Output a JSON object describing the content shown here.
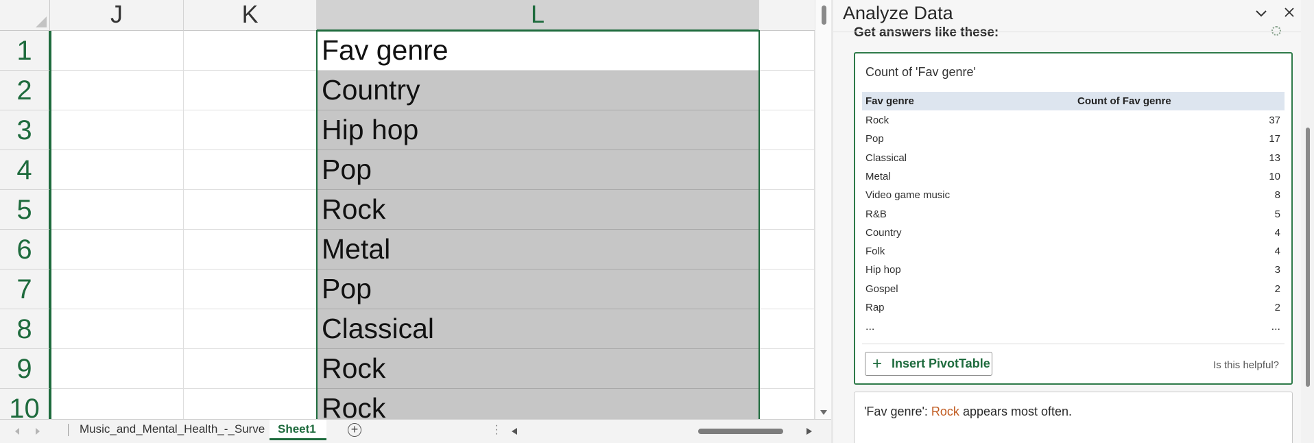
{
  "grid": {
    "columns": [
      "J",
      "K",
      "L"
    ],
    "row_numbers": [
      "1",
      "2",
      "3",
      "4",
      "5",
      "6",
      "7",
      "8",
      "9",
      "10"
    ],
    "column_l_values": [
      "Fav genre",
      "Country",
      "Hip hop",
      "Pop",
      "Rock",
      "Metal",
      "Pop",
      "Classical",
      "Rock",
      "Rock"
    ]
  },
  "sheet_tabs": {
    "tabs": [
      "Music_and_Mental_Health_-_Surve",
      "Sheet1"
    ],
    "active": "Sheet1"
  },
  "analyze_pane": {
    "title": "Analyze Data",
    "collapse_glyph": "⌄",
    "close_glyph": "✕",
    "section_heading": "Get answers like these:",
    "card": {
      "title": "Count of 'Fav genre'",
      "headers": [
        "Fav genre",
        "Count of Fav genre"
      ],
      "rows": [
        {
          "genre": "Rock",
          "count": "37"
        },
        {
          "genre": "Pop",
          "count": "17"
        },
        {
          "genre": "Classical",
          "count": "13"
        },
        {
          "genre": "Metal",
          "count": "10"
        },
        {
          "genre": "Video game music",
          "count": "8"
        },
        {
          "genre": "R&B",
          "count": "5"
        },
        {
          "genre": "Country",
          "count": "4"
        },
        {
          "genre": "Folk",
          "count": "4"
        },
        {
          "genre": "Hip hop",
          "count": "3"
        },
        {
          "genre": "Gospel",
          "count": "2"
        },
        {
          "genre": "Rap",
          "count": "2"
        }
      ],
      "ellipsis": "...",
      "insert_button": "Insert PivotTable",
      "insert_icon": "+",
      "helpful": "Is this helpful?"
    },
    "insight": {
      "prefix": "'Fav genre': ",
      "highlight": "Rock",
      "suffix": " appears most often."
    }
  },
  "colors": {
    "accent": "#1e6b3d",
    "selection_fill": "#c6c6c6",
    "highlight_text": "#c05a1f",
    "table_header_bg": "#dde5ef"
  }
}
